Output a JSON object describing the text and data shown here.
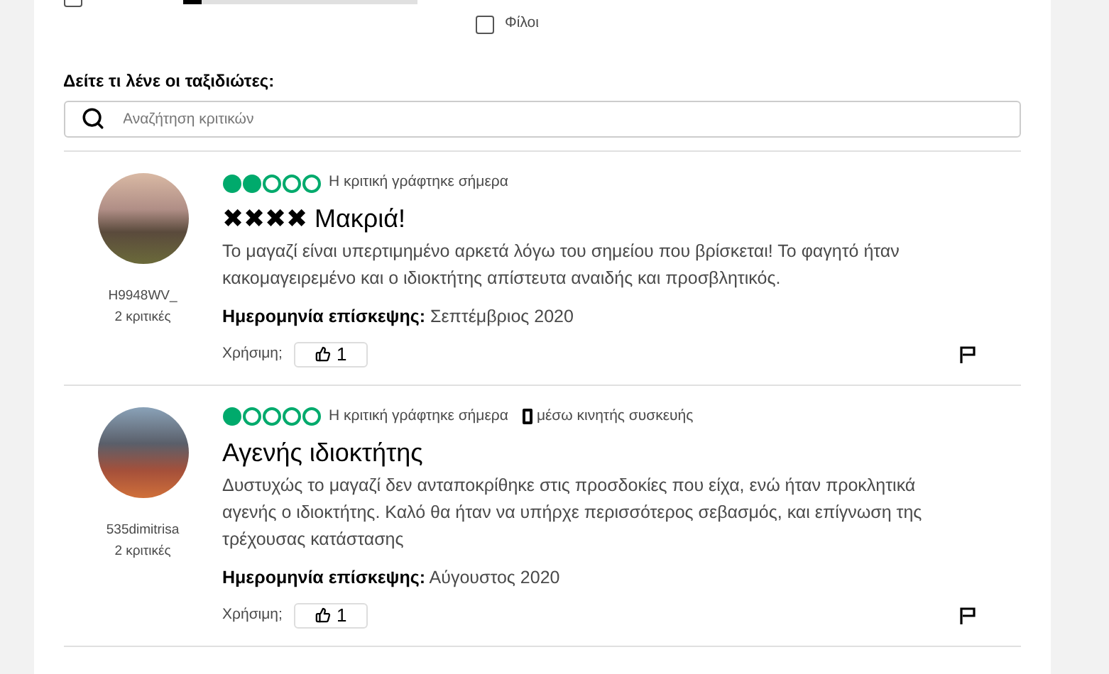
{
  "filters": {
    "rating_row": {
      "checked": false,
      "level": 0.08
    },
    "friends": {
      "label": "Φίλοι",
      "checked": false
    }
  },
  "reviews_heading": "Δείτε τι λένε οι ταξιδιώτες:",
  "search": {
    "placeholder": "Αναζήτηση κριτικών"
  },
  "reviews": [
    {
      "username": "H9948WV_",
      "count": "2 κριτικές",
      "stars": 2,
      "written": "Η κριτική γράφτηκε σήμερα",
      "title": "✖✖✖✖ Μακριά!",
      "body": "Το μαγαζί είναι υπερτιμημένο αρκετά λόγω του σημείου που βρίσκεται! Το φαγητό ήταν κακομαγειρεμένο και ο ιδιοκτήτης απίστευτα αναιδής και προσβλητικός.",
      "visit_label": "Ημερομηνία επίσκεψης:",
      "visit": "Σεπτέμβριος 2020",
      "helpful_label": "Χρήσιμη;",
      "helpful_count": "1"
    },
    {
      "username": "535dimitrisa",
      "count": "2 κριτικές",
      "stars": 1,
      "written": "Η κριτική γράφτηκε σήμερα",
      "mobile": "μέσω κινητής συσκευής",
      "title": "Αγενής ιδιοκτήτης",
      "body": "Δυστυχώς το μαγαζί δεν ανταποκρίθηκε στις προσδοκίες που είχα, ενώ ήταν προκλητικά αγενής ο ιδιοκτήτης. Καλό θα ήταν να υπήρχε περισσότερος σεβασμός, και επίγνωση της τρέχουσας κατάστασης",
      "visit_label": "Ημερομηνία επίσκεψης:",
      "visit": "Αύγουστος 2020",
      "helpful_label": "Χρήσιμη;",
      "helpful_count": "1"
    }
  ]
}
